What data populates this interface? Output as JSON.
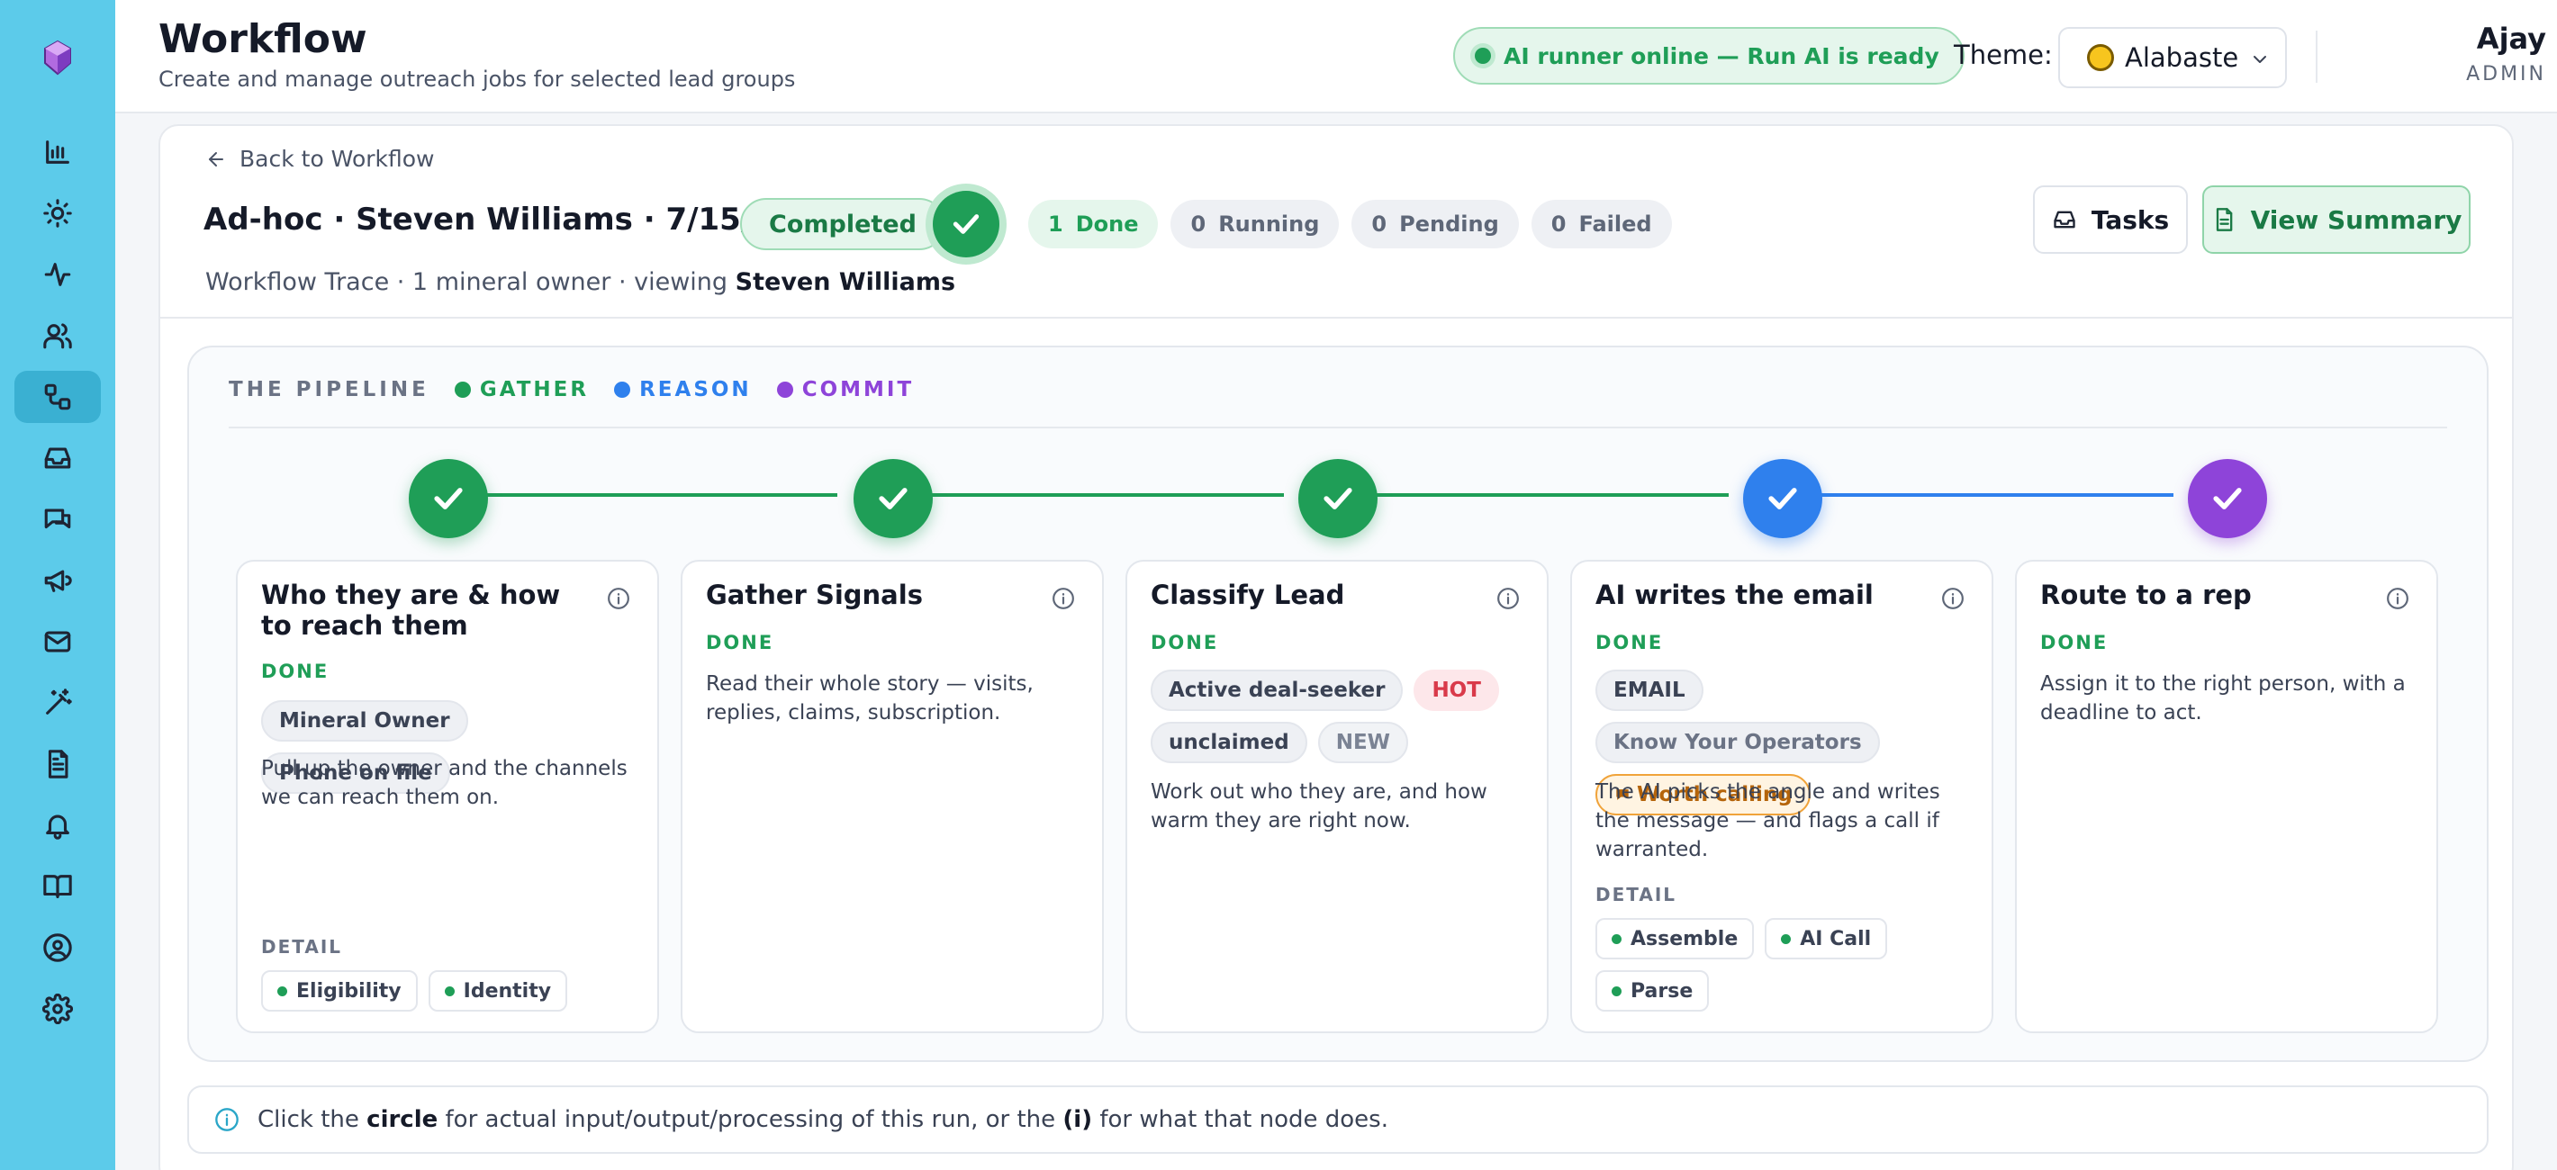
{
  "header": {
    "title": "Workflow",
    "subtitle": "Create and manage outreach jobs for selected lead groups",
    "ai_status": "AI runner online — Run AI is ready",
    "theme_label": "Theme:",
    "theme_value": "Alabaster",
    "user_name": "Ajay",
    "user_role": "ADMIN"
  },
  "sidebar": {
    "items": [
      {
        "icon": "bar-chart-icon"
      },
      {
        "icon": "sun-icon"
      },
      {
        "icon": "activity-icon"
      },
      {
        "icon": "users-icon"
      },
      {
        "icon": "workflow-icon",
        "active": true
      },
      {
        "icon": "inbox-icon"
      },
      {
        "icon": "chat-icon"
      },
      {
        "icon": "megaphone-icon"
      },
      {
        "icon": "mail-icon"
      },
      {
        "icon": "magic-wand-icon"
      },
      {
        "icon": "document-icon"
      },
      {
        "icon": "bell-icon"
      },
      {
        "icon": "book-icon"
      },
      {
        "icon": "user-circle-icon"
      },
      {
        "icon": "gear-icon"
      }
    ]
  },
  "run": {
    "back_label": "Back to Workflow",
    "title": "Ad-hoc · Steven Williams · 7/15/2026",
    "status": "Completed",
    "counts": {
      "done": {
        "value": "1",
        "label": "Done"
      },
      "running": {
        "value": "0",
        "label": "Running"
      },
      "pending": {
        "value": "0",
        "label": "Pending"
      },
      "failed": {
        "value": "0",
        "label": "Failed"
      }
    },
    "meta_prefix": "Workflow Trace · 1 mineral owner · viewing",
    "meta_name": "Steven Williams",
    "tasks_label": "Tasks",
    "summary_label": "View Summary"
  },
  "pipeline": {
    "title": "THE PIPELINE",
    "legend": [
      {
        "label": "GATHER",
        "color": "#1f9e57"
      },
      {
        "label": "REASON",
        "color": "#2f80ed"
      },
      {
        "label": "COMMIT",
        "color": "#8e44d9"
      }
    ],
    "stages": [
      {
        "title": "Who they are & how to reach them",
        "status": "DONE",
        "tags": [
          "Mineral Owner",
          "Phone on file"
        ],
        "description": "Pull up the owner and the channels we can reach them on.",
        "detail_label": "DETAIL",
        "details": [
          "Eligibility",
          "Identity"
        ]
      },
      {
        "title": "Gather Signals",
        "status": "DONE",
        "description": "Read their whole story — visits, replies, claims, subscription."
      },
      {
        "title": "Classify Lead",
        "status": "DONE",
        "tags": [
          "Active deal-seeker",
          "HOT",
          "unclaimed",
          "NEW"
        ],
        "description": "Work out who they are, and how warm they are right now."
      },
      {
        "title": "AI writes the email",
        "status": "DONE",
        "tags": [
          "EMAIL",
          "Know Your Operators",
          "Worth calling"
        ],
        "description": "The AI picks the angle and writes the message — and flags a call if warranted.",
        "detail_label": "DETAIL",
        "details": [
          "Assemble",
          "AI Call",
          "Parse"
        ]
      },
      {
        "title": "Route to a rep",
        "status": "DONE",
        "description": "Assign it to the right person, with a deadline to act."
      }
    ]
  },
  "note": {
    "part1": "Click the",
    "bold1": "circle",
    "part2": "for actual input/output/processing of this run, or the",
    "bold2": "(i)",
    "part3": "for what that node does."
  }
}
